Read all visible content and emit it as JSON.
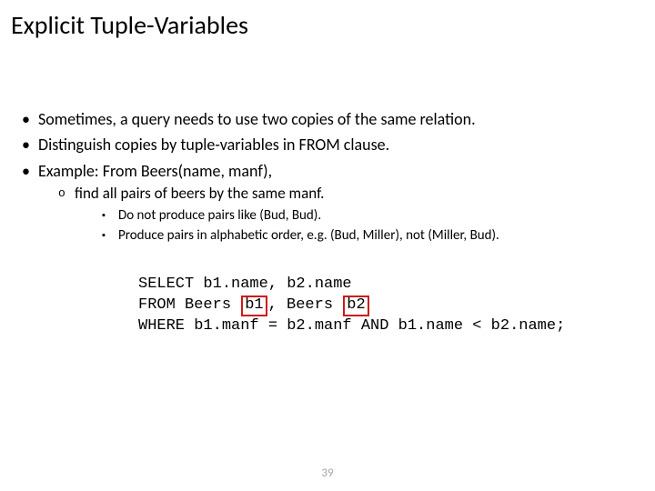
{
  "title": "Explicit Tuple-Variables",
  "bullets": {
    "b1a": "Sometimes, a query needs to use two copies of the same relation.",
    "b1b": "Distinguish copies by tuple-variables in FROM clause.",
    "b1c": "Example: From Beers(name, manf),",
    "b2a": "find all pairs of beers by the same manf.",
    "b3a": "Do not produce pairs like (Bud, Bud).",
    "b3b": "Produce pairs in alphabetic order, e.g. (Bud, Miller), not (Miller, Bud)."
  },
  "code": {
    "l1a": "SELECT b1.name, b2.name",
    "l2a": "FROM Beers ",
    "l2b": "b1",
    "l2c": ", Beers ",
    "l2d": "b2",
    "l3a": "WHERE b1.manf = b2.manf AND b1.name < b2.name;"
  },
  "page": "39"
}
